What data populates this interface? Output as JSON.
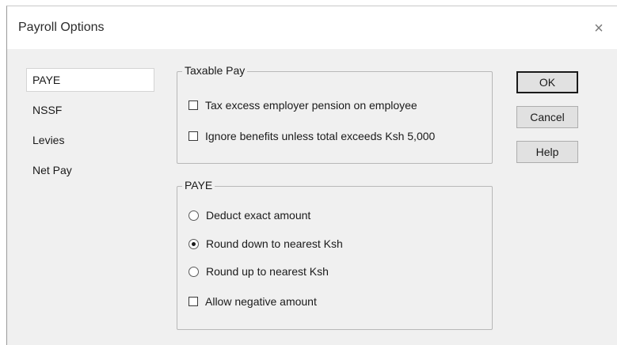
{
  "window": {
    "title": "Payroll Options",
    "close_glyph": "×"
  },
  "nav": {
    "items": [
      {
        "label": "PAYE",
        "selected": true
      },
      {
        "label": "NSSF",
        "selected": false
      },
      {
        "label": "Levies",
        "selected": false
      },
      {
        "label": "Net Pay",
        "selected": false
      }
    ]
  },
  "taxable_pay": {
    "title": "Taxable Pay",
    "options": [
      {
        "label": "Tax excess employer pension on employee",
        "checked": false
      },
      {
        "label": "Ignore benefits unless total exceeds Ksh 5,000",
        "checked": false
      }
    ]
  },
  "paye": {
    "title": "PAYE",
    "radios": [
      {
        "label": "Deduct exact amount",
        "checked": false
      },
      {
        "label": "Round down to nearest Ksh",
        "checked": true
      },
      {
        "label": "Round up to nearest Ksh",
        "checked": false
      }
    ],
    "allow_negative": {
      "label": "Allow negative amount",
      "checked": false
    }
  },
  "buttons": {
    "ok": "OK",
    "cancel": "Cancel",
    "help": "Help"
  }
}
